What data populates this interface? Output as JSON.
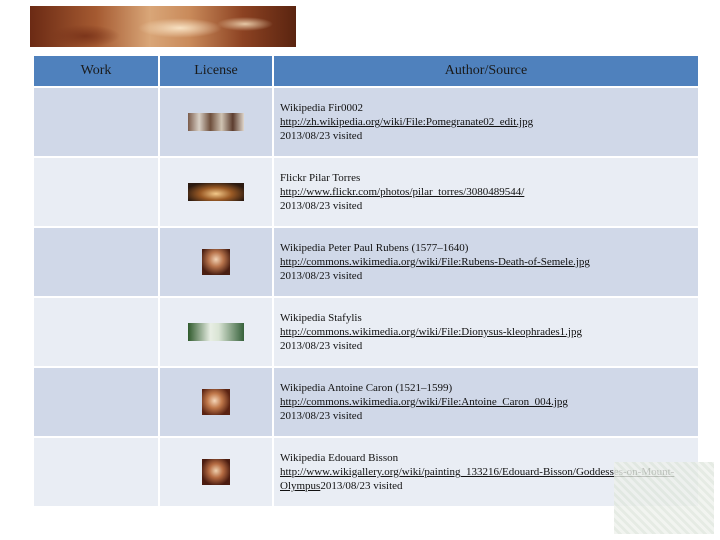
{
  "header": {
    "work": "Work",
    "license": "License",
    "author_source": "Author/Source"
  },
  "rows": [
    {
      "thumb_icon": "painting-thumbnail-icon",
      "line1": "Wikipedia Fir0002",
      "link": "http://zh.wikipedia.org/wiki/File:Pomegranate02_edit.jpg",
      "visited": "2013/08/23 visited"
    },
    {
      "thumb_icon": "photo-thumbnail-icon",
      "line1": "Flickr Pilar Torres",
      "link": "http://www.flickr.com/photos/pilar_torres/3080489544/",
      "visited": "2013/08/23 visited"
    },
    {
      "thumb_icon": "painting-thumbnail-icon",
      "line1": "Wikipedia Peter Paul Rubens (1577–1640)",
      "link": "http://commons.wikimedia.org/wiki/File:Rubens-Death-of-Semele.jpg",
      "visited": "2013/08/23 visited"
    },
    {
      "thumb_icon": "vase-thumbnail-icon",
      "line1": "Wikipedia Stafylis",
      "link": "http://commons.wikimedia.org/wiki/File:Dionysus-kleophrades1.jpg",
      "visited": "2013/08/23 visited"
    },
    {
      "thumb_icon": "painting-thumbnail-icon",
      "line1": "Wikipedia Antoine Caron (1521–1599)",
      "link": "http://commons.wikimedia.org/wiki/File:Antoine_Caron_004.jpg",
      "visited": "2013/08/23 visited"
    },
    {
      "thumb_icon": "painting-thumbnail-icon",
      "line1": "Wikipedia Edouard Bisson",
      "link": "http://www.wikigallery.org/wiki/painting_133216/Edouard-Bisson/Goddesses-on-Mount-Olympus",
      "visited": "2013/08/23 visited"
    }
  ],
  "colors": {
    "header_bg": "#4f81bd",
    "row_odd": "#d0d8e8",
    "row_even": "#e9edf4"
  }
}
